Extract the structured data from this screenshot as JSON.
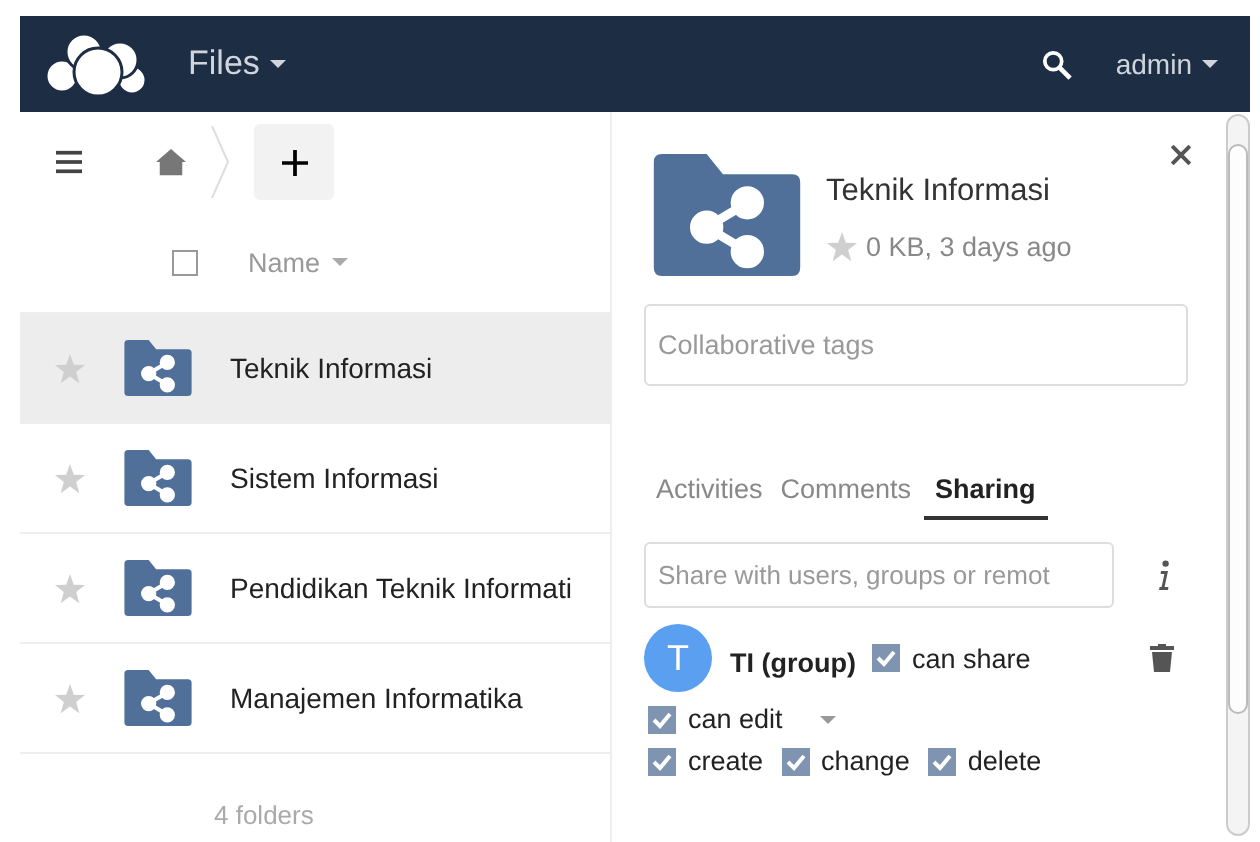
{
  "header": {
    "app_title": "Files",
    "user": "admin"
  },
  "file_list": {
    "select_all": {
      "checked": false
    },
    "column": "Name",
    "rows": [
      {
        "name": "Teknik Informasi",
        "selected": true,
        "favorite": false
      },
      {
        "name": "Sistem Informasi",
        "selected": false,
        "favorite": false
      },
      {
        "name": "Pendidikan Teknik Informati",
        "selected": false,
        "favorite": false
      },
      {
        "name": "Manajemen Informatika",
        "selected": false,
        "favorite": false
      }
    ],
    "summary": "4 folders"
  },
  "details": {
    "title": "Teknik Informasi",
    "favorite": false,
    "meta": "0 KB, 3 days ago",
    "tags_placeholder": "Collaborative tags",
    "tabs": [
      {
        "label": "Activities",
        "selected": false
      },
      {
        "label": "Comments",
        "selected": false
      },
      {
        "label": "Sharing",
        "selected": true
      }
    ],
    "share_placeholder": "Share with users, groups or remot",
    "share": {
      "initial": "T",
      "name": "TI (group)",
      "can_share": {
        "label": "can share",
        "checked": true
      },
      "can_edit": {
        "label": "can edit",
        "checked": true
      },
      "permissions": [
        {
          "label": "create",
          "checked": true
        },
        {
          "label": "change",
          "checked": true
        },
        {
          "label": "delete",
          "checked": true
        }
      ]
    }
  }
}
